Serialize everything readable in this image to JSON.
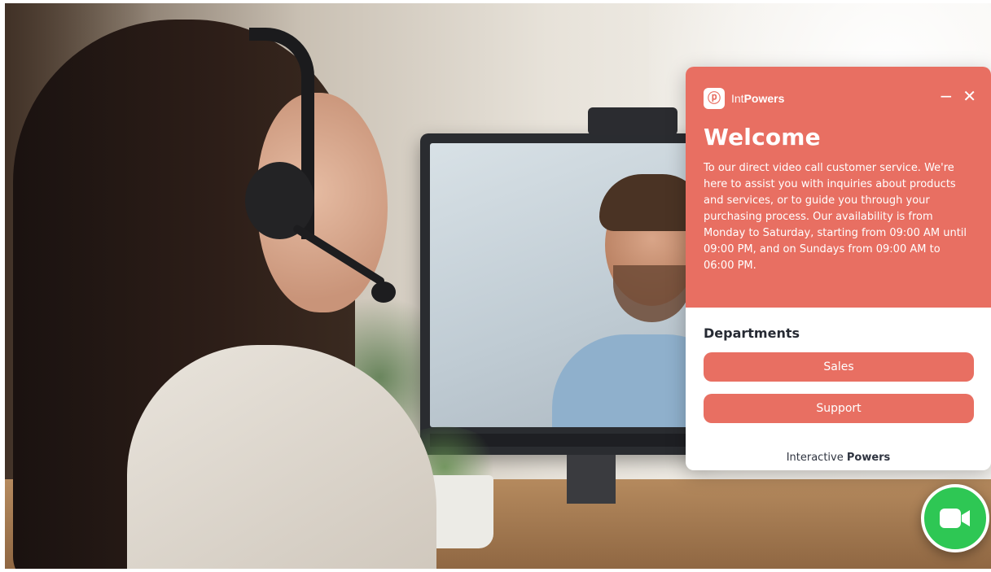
{
  "widget": {
    "brand": {
      "light": "Int",
      "bold": "Powers"
    },
    "controls": {
      "minimize_glyph": "−",
      "close_glyph": "✕"
    },
    "welcome_title": "Welcome",
    "welcome_text": "To our direct video call customer service. We're here to assist you with inquiries about products and services, or to guide you through your purchasing process. Our availability is from Monday to Saturday, starting from 09:00 AM until 09:00 PM, and on Sundays from 09:00 AM to 06:00 PM.",
    "departments_title": "Departments",
    "departments": [
      {
        "label": "Sales"
      },
      {
        "label": "Support"
      }
    ],
    "footer": {
      "prefix": "Interactive ",
      "bold": "Powers"
    }
  },
  "video_button": {
    "icon": "video-camera-icon"
  },
  "colors": {
    "accent": "#e86f62",
    "fab_green": "#2ec754",
    "dark_text": "#262a33"
  }
}
